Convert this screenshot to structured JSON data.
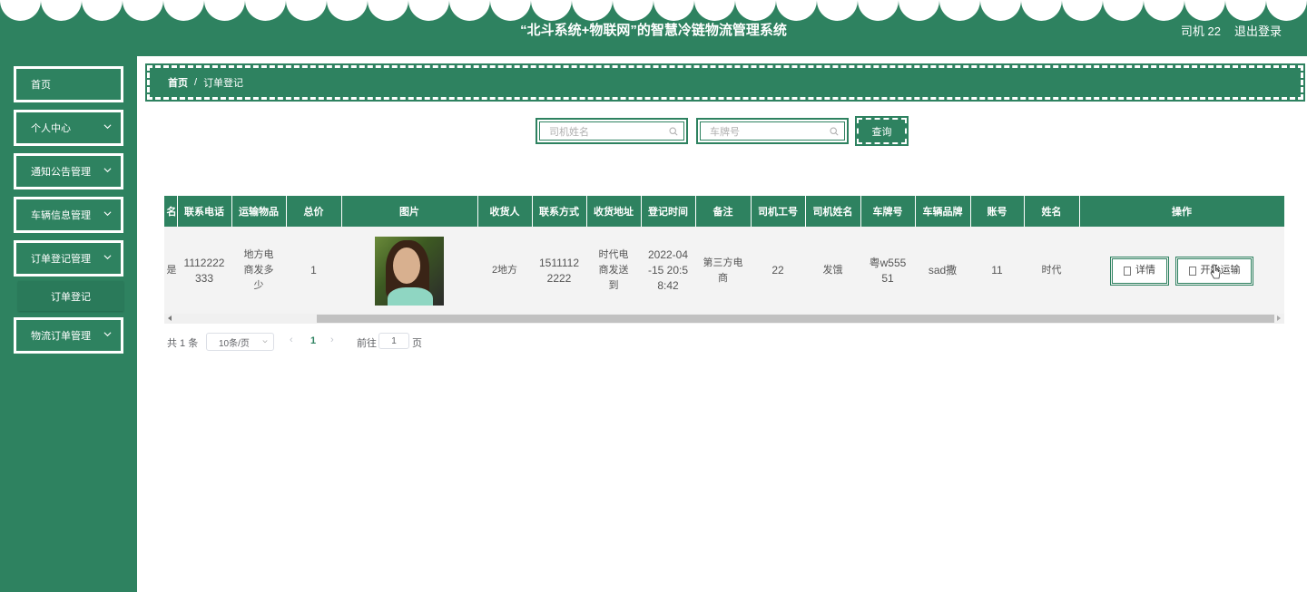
{
  "header": {
    "title": "“北斗系统+物联网”的智慧冷链物流管理系统",
    "user": "司机 22",
    "logout": "退出登录",
    "color": "#2e8260"
  },
  "sidebar": {
    "items": [
      {
        "label": "首页",
        "expandable": false
      },
      {
        "label": "个人中心",
        "expandable": true
      },
      {
        "label": "通知公告管理",
        "expandable": true
      },
      {
        "label": "车辆信息管理",
        "expandable": true
      },
      {
        "label": "订单登记管理",
        "expandable": true
      },
      {
        "label": "物流订单管理",
        "expandable": true
      }
    ],
    "sub_item": "订单登记"
  },
  "breadcrumb": {
    "home": "首页",
    "separator": "/",
    "current": "订单登记"
  },
  "search": {
    "driver_name_placeholder": "司机姓名",
    "plate_placeholder": "车牌号",
    "button": "查询"
  },
  "table": {
    "columns": [
      "名",
      "联系电话",
      "运输物品",
      "总价",
      "图片",
      "收货人",
      "联系方式",
      "收货地址",
      "登记时间",
      "备注",
      "司机工号",
      "司机姓名",
      "车牌号",
      "车辆品牌",
      "账号",
      "姓名",
      "操作"
    ],
    "rows": [
      {
        "name_partial": "是",
        "phone": "1112222333",
        "goods": "地方电商发多少",
        "total": "1",
        "receiver": "2地方",
        "contact": "15111122222",
        "address": "时代电商发送到",
        "reg_time": "2022-04-15 20:58:42",
        "note": "第三方电商",
        "driver_id": "22",
        "driver_name": "发饿",
        "plate": "粤w55551",
        "brand": "sad撒",
        "account": "11",
        "person": "时代",
        "actions": [
          "详情",
          "开始运输"
        ]
      }
    ]
  },
  "pagination": {
    "total": "共 1 条",
    "page_size": "10条/页",
    "current_page": "1",
    "goto_label": "前往",
    "goto_value": "1",
    "page_suffix": "页"
  }
}
